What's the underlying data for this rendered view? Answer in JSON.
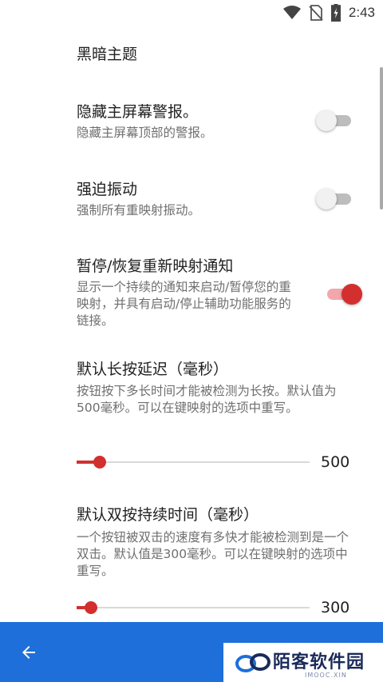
{
  "status_bar": {
    "time": "2:43",
    "icons": [
      "wifi-icon",
      "no-sim-icon",
      "battery-charging-icon"
    ]
  },
  "settings": {
    "dark_theme": {
      "title": "黑暗主题"
    },
    "hide_alert": {
      "title": "隐藏主屏幕警报。",
      "summary": "隐藏主屏幕顶部的警报。",
      "enabled": false
    },
    "force_vibrate": {
      "title": "强迫振动",
      "summary": "强制所有重映射振动。",
      "enabled": false
    },
    "pause_notification": {
      "title": "暂停/恢复重新映射通知",
      "summary": "显示一个持续的通知来启动/暂停您的重映射，并具有启动/停止辅助功能服务的链接。",
      "enabled": true
    },
    "long_press": {
      "title": "默认长按延迟（毫秒）",
      "summary": "按钮按下多长时间才能被检测为长按。默认值为500毫秒。可以在键映射的选项中重写。",
      "value": "500",
      "fraction": 0.1
    },
    "double_press": {
      "title": "默认双按持续时间（毫秒）",
      "summary": "一个按钮被双击的速度有多快才能被检测到是一个双击。默认值是300毫秒。可以在键映射的选项中重写。",
      "value": "300",
      "fraction": 0.06
    }
  },
  "bottom_bar": {
    "back_icon": "arrow-left-icon"
  },
  "watermark": {
    "text": "陌客软件园",
    "sub": "IMOOC.XIN"
  },
  "colors": {
    "accent": "#d32f2f",
    "bottom_bar": "#1e6fd9"
  }
}
